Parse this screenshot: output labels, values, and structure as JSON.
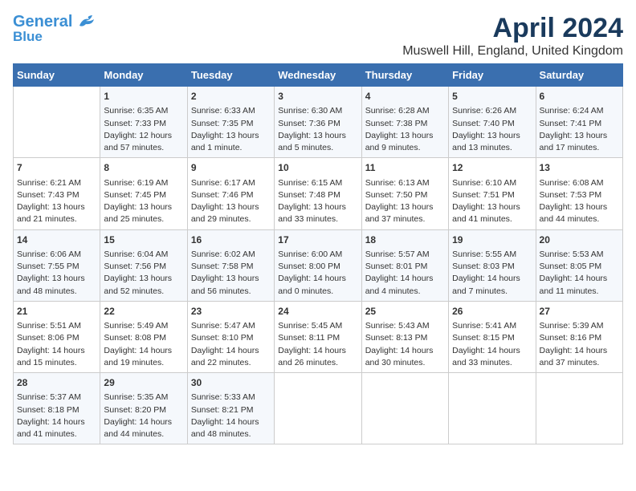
{
  "header": {
    "logo_line1": "General",
    "logo_line2": "Blue",
    "month": "April 2024",
    "location": "Muswell Hill, England, United Kingdom"
  },
  "days_of_week": [
    "Sunday",
    "Monday",
    "Tuesday",
    "Wednesday",
    "Thursday",
    "Friday",
    "Saturday"
  ],
  "weeks": [
    [
      {
        "day": "",
        "info": ""
      },
      {
        "day": "1",
        "info": "Sunrise: 6:35 AM\nSunset: 7:33 PM\nDaylight: 12 hours\nand 57 minutes."
      },
      {
        "day": "2",
        "info": "Sunrise: 6:33 AM\nSunset: 7:35 PM\nDaylight: 13 hours\nand 1 minute."
      },
      {
        "day": "3",
        "info": "Sunrise: 6:30 AM\nSunset: 7:36 PM\nDaylight: 13 hours\nand 5 minutes."
      },
      {
        "day": "4",
        "info": "Sunrise: 6:28 AM\nSunset: 7:38 PM\nDaylight: 13 hours\nand 9 minutes."
      },
      {
        "day": "5",
        "info": "Sunrise: 6:26 AM\nSunset: 7:40 PM\nDaylight: 13 hours\nand 13 minutes."
      },
      {
        "day": "6",
        "info": "Sunrise: 6:24 AM\nSunset: 7:41 PM\nDaylight: 13 hours\nand 17 minutes."
      }
    ],
    [
      {
        "day": "7",
        "info": "Sunrise: 6:21 AM\nSunset: 7:43 PM\nDaylight: 13 hours\nand 21 minutes."
      },
      {
        "day": "8",
        "info": "Sunrise: 6:19 AM\nSunset: 7:45 PM\nDaylight: 13 hours\nand 25 minutes."
      },
      {
        "day": "9",
        "info": "Sunrise: 6:17 AM\nSunset: 7:46 PM\nDaylight: 13 hours\nand 29 minutes."
      },
      {
        "day": "10",
        "info": "Sunrise: 6:15 AM\nSunset: 7:48 PM\nDaylight: 13 hours\nand 33 minutes."
      },
      {
        "day": "11",
        "info": "Sunrise: 6:13 AM\nSunset: 7:50 PM\nDaylight: 13 hours\nand 37 minutes."
      },
      {
        "day": "12",
        "info": "Sunrise: 6:10 AM\nSunset: 7:51 PM\nDaylight: 13 hours\nand 41 minutes."
      },
      {
        "day": "13",
        "info": "Sunrise: 6:08 AM\nSunset: 7:53 PM\nDaylight: 13 hours\nand 44 minutes."
      }
    ],
    [
      {
        "day": "14",
        "info": "Sunrise: 6:06 AM\nSunset: 7:55 PM\nDaylight: 13 hours\nand 48 minutes."
      },
      {
        "day": "15",
        "info": "Sunrise: 6:04 AM\nSunset: 7:56 PM\nDaylight: 13 hours\nand 52 minutes."
      },
      {
        "day": "16",
        "info": "Sunrise: 6:02 AM\nSunset: 7:58 PM\nDaylight: 13 hours\nand 56 minutes."
      },
      {
        "day": "17",
        "info": "Sunrise: 6:00 AM\nSunset: 8:00 PM\nDaylight: 14 hours\nand 0 minutes."
      },
      {
        "day": "18",
        "info": "Sunrise: 5:57 AM\nSunset: 8:01 PM\nDaylight: 14 hours\nand 4 minutes."
      },
      {
        "day": "19",
        "info": "Sunrise: 5:55 AM\nSunset: 8:03 PM\nDaylight: 14 hours\nand 7 minutes."
      },
      {
        "day": "20",
        "info": "Sunrise: 5:53 AM\nSunset: 8:05 PM\nDaylight: 14 hours\nand 11 minutes."
      }
    ],
    [
      {
        "day": "21",
        "info": "Sunrise: 5:51 AM\nSunset: 8:06 PM\nDaylight: 14 hours\nand 15 minutes."
      },
      {
        "day": "22",
        "info": "Sunrise: 5:49 AM\nSunset: 8:08 PM\nDaylight: 14 hours\nand 19 minutes."
      },
      {
        "day": "23",
        "info": "Sunrise: 5:47 AM\nSunset: 8:10 PM\nDaylight: 14 hours\nand 22 minutes."
      },
      {
        "day": "24",
        "info": "Sunrise: 5:45 AM\nSunset: 8:11 PM\nDaylight: 14 hours\nand 26 minutes."
      },
      {
        "day": "25",
        "info": "Sunrise: 5:43 AM\nSunset: 8:13 PM\nDaylight: 14 hours\nand 30 minutes."
      },
      {
        "day": "26",
        "info": "Sunrise: 5:41 AM\nSunset: 8:15 PM\nDaylight: 14 hours\nand 33 minutes."
      },
      {
        "day": "27",
        "info": "Sunrise: 5:39 AM\nSunset: 8:16 PM\nDaylight: 14 hours\nand 37 minutes."
      }
    ],
    [
      {
        "day": "28",
        "info": "Sunrise: 5:37 AM\nSunset: 8:18 PM\nDaylight: 14 hours\nand 41 minutes."
      },
      {
        "day": "29",
        "info": "Sunrise: 5:35 AM\nSunset: 8:20 PM\nDaylight: 14 hours\nand 44 minutes."
      },
      {
        "day": "30",
        "info": "Sunrise: 5:33 AM\nSunset: 8:21 PM\nDaylight: 14 hours\nand 48 minutes."
      },
      {
        "day": "",
        "info": ""
      },
      {
        "day": "",
        "info": ""
      },
      {
        "day": "",
        "info": ""
      },
      {
        "day": "",
        "info": ""
      }
    ]
  ]
}
